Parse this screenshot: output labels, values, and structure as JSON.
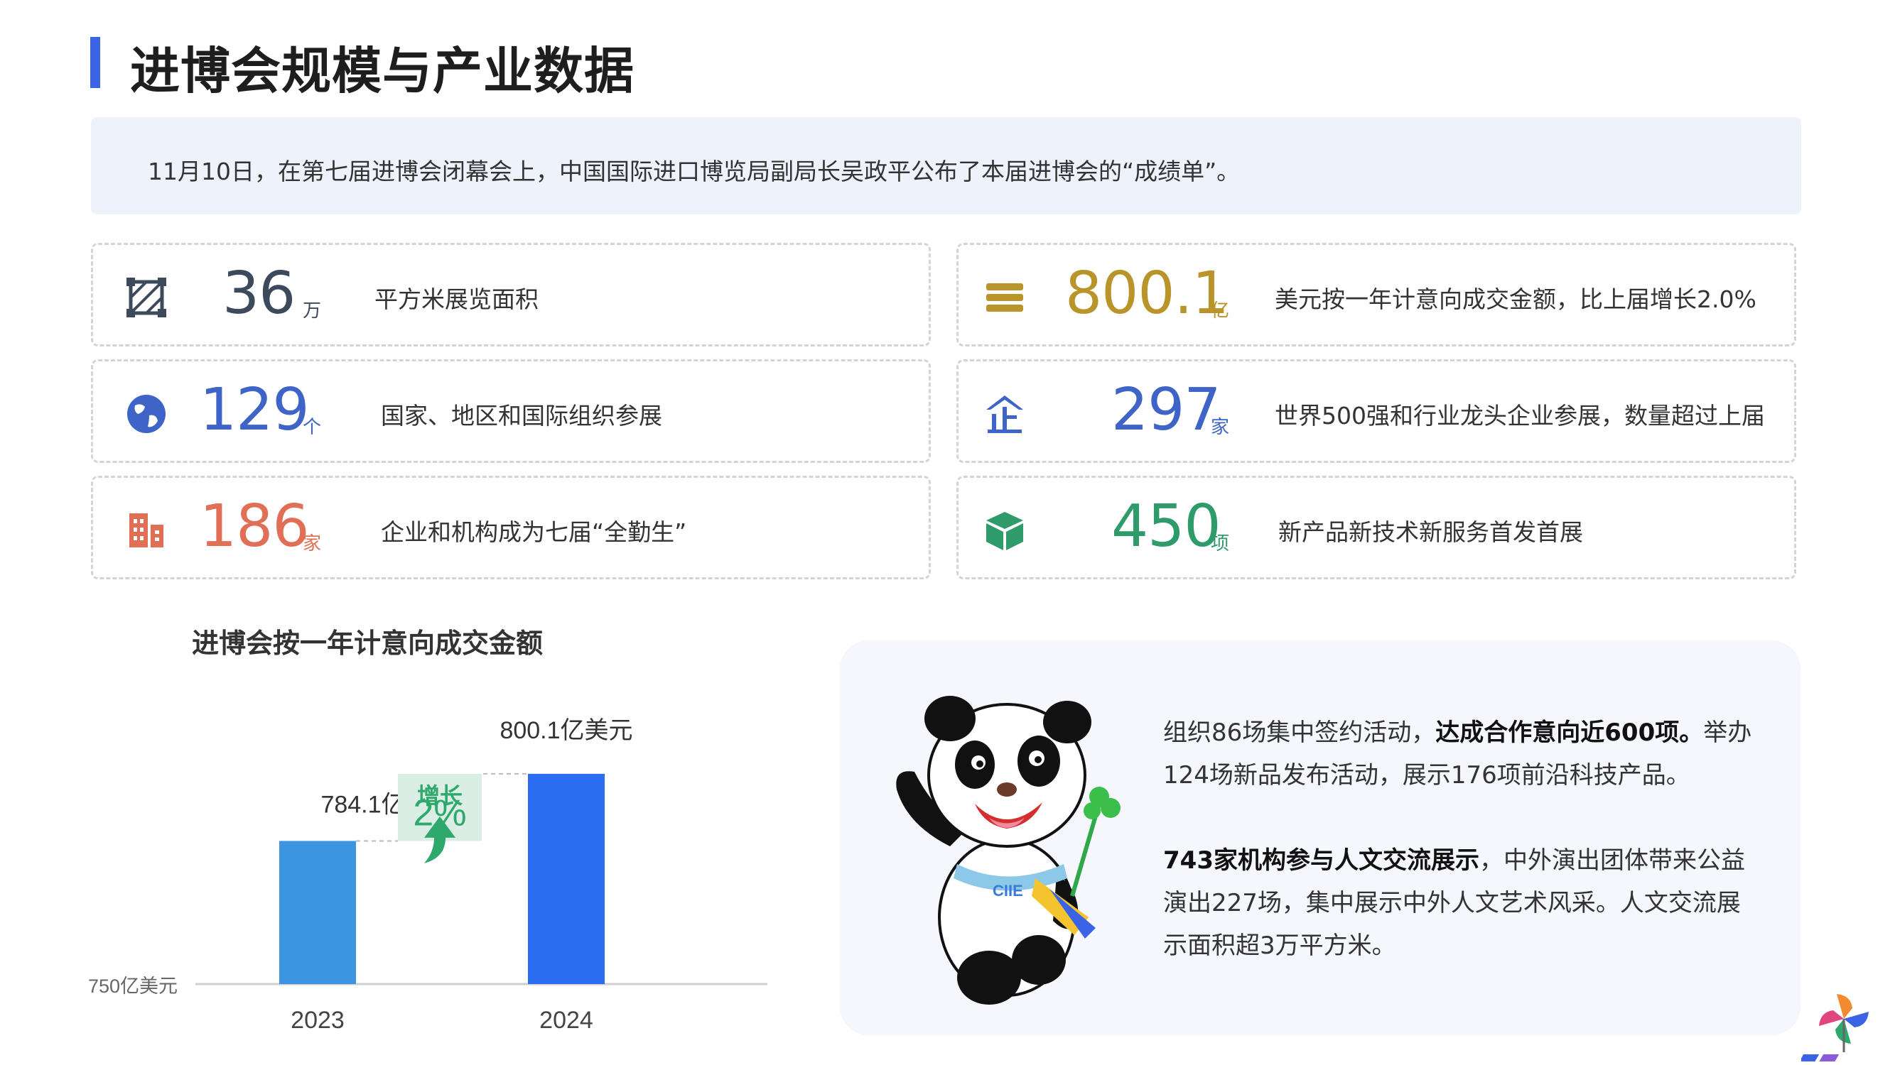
{
  "page": {
    "title": "进博会规模与产业数据",
    "intro": "11月10日，在第七届进博会闭幕会上，中国国际进口博览局副局长吴政平公布了本届进博会的“成绩单”。"
  },
  "stats": [
    {
      "value": "36",
      "unit": "万",
      "desc": "平方米展览面积",
      "color": "#3d4a5c",
      "icon": "area-icon"
    },
    {
      "value": "800.1",
      "unit": "亿",
      "desc": "美元按一年计意向成交金额，比上届增长2.0%",
      "color": "#b8942a",
      "icon": "money-stack-icon"
    },
    {
      "value": "129",
      "unit": "个",
      "desc": "国家、地区和国际组织参展",
      "color": "#3f64c8",
      "icon": "globe-icon"
    },
    {
      "value": "297",
      "unit": "家",
      "desc": "世界500强和行业龙头企业参展，数量超过上届",
      "color": "#3f64c8",
      "icon": "enterprise-icon"
    },
    {
      "value": "186",
      "unit": "家",
      "desc": "企业和机构成为七届“全勤生”",
      "color": "#e06f55",
      "icon": "building-icon"
    },
    {
      "value": "450",
      "unit": "项",
      "desc": "新产品新技术新服务首发首展",
      "color": "#2f9a6a",
      "icon": "box-icon"
    }
  ],
  "chart_data": {
    "type": "bar",
    "title": "进博会按一年计意向成交金额",
    "categories": [
      "2023",
      "2024"
    ],
    "values": [
      784.1,
      800.1
    ],
    "data_labels": [
      "784.1亿美元",
      "800.1亿美元"
    ],
    "baseline_label": "750亿美元",
    "ylim": [
      750,
      806
    ],
    "colors": [
      "#3d95df",
      "#2b6cf0"
    ],
    "growth": {
      "label": "增长",
      "value": "2%",
      "color": "#2fa86c"
    },
    "grid": false
  },
  "info": {
    "para1_bold": "达成合作意向近600项。",
    "para1_a": "组织86场集中签约活动，",
    "para1_b": "举办124场新品发布活动，展示176项前沿科技产品。",
    "para2_bold": "743家机构参与人文交流展示",
    "para2_rest": "，中外演出团体带来公益演出227场，集中展示中外人文艺术风采。人文交流展示面积超3万平方米。",
    "mascot_badge": "CIIE"
  }
}
